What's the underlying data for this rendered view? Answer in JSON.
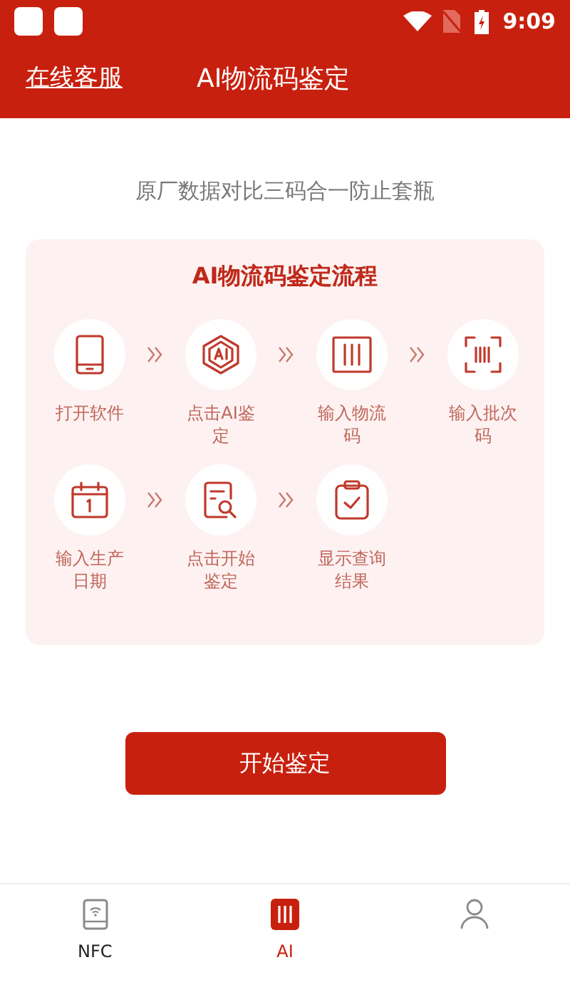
{
  "status_bar": {
    "time": "9:09"
  },
  "header": {
    "link": "在线客服",
    "title": "AI物流码鉴定"
  },
  "subtitle": "原厂数据对比三码合一防止套瓶",
  "process": {
    "title": "AI物流码鉴定流程",
    "rows": [
      [
        {
          "kind": "phone",
          "label": "打开软件"
        },
        {
          "kind": "ai",
          "label": "点击AI鉴定"
        },
        {
          "kind": "barcode",
          "label": "输入物流码"
        },
        {
          "kind": "scan",
          "label": "输入批次码"
        }
      ],
      [
        {
          "kind": "calendar",
          "label": "输入生产日期"
        },
        {
          "kind": "search",
          "label": "点击开始鉴定"
        },
        {
          "kind": "check",
          "label": "显示查询结果"
        }
      ]
    ]
  },
  "start_button": "开始鉴定",
  "tabs": [
    {
      "kind": "nfc",
      "label": "NFC",
      "selected": false
    },
    {
      "kind": "ai",
      "label": "AI",
      "selected": true
    },
    {
      "kind": "user",
      "selected": false
    }
  ]
}
